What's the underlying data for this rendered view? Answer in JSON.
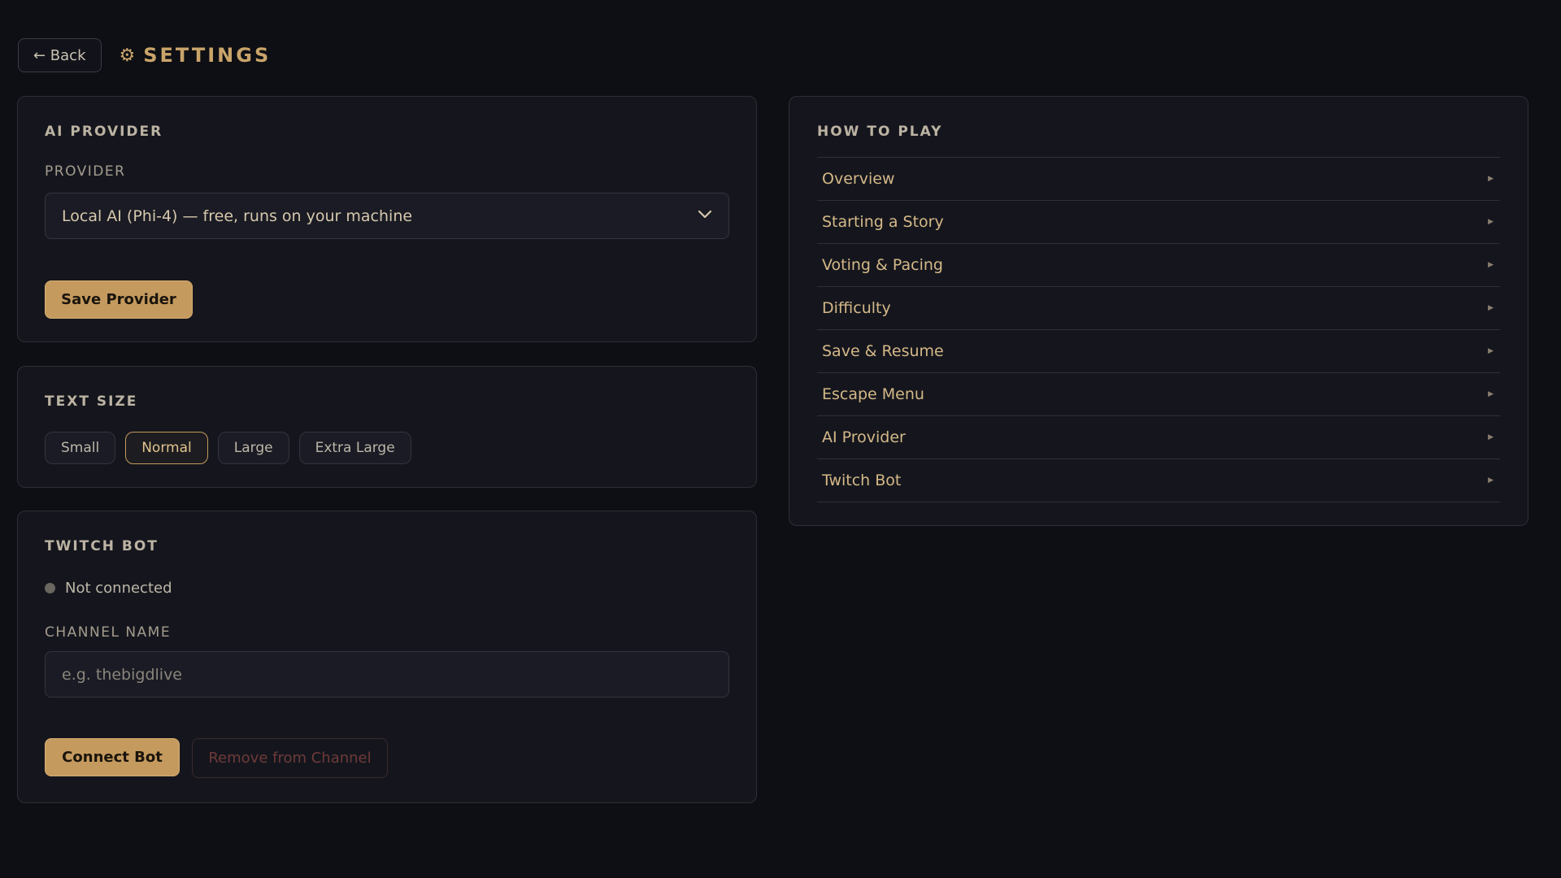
{
  "header": {
    "back_label": "← Back",
    "title_icon": "gear-icon",
    "title": "SETTINGS"
  },
  "ai_provider": {
    "heading": "AI PROVIDER",
    "provider_label": "PROVIDER",
    "selected_value": "Local AI (Phi-4) — free, runs on your machine",
    "save_label": "Save Provider"
  },
  "text_size": {
    "heading": "TEXT SIZE",
    "options": [
      "Small",
      "Normal",
      "Large",
      "Extra Large"
    ],
    "selected": "Normal"
  },
  "twitch_bot": {
    "heading": "TWITCH BOT",
    "status": "Not connected",
    "channel_label": "CHANNEL NAME",
    "channel_value": "",
    "channel_placeholder": "e.g. thebigdlive",
    "connect_label": "Connect Bot",
    "remove_label": "Remove from Channel"
  },
  "how_to_play": {
    "heading": "HOW TO PLAY",
    "items": [
      {
        "label": "Overview"
      },
      {
        "label": "Starting a Story"
      },
      {
        "label": "Voting & Pacing"
      },
      {
        "label": "Difficulty"
      },
      {
        "label": "Save & Resume"
      },
      {
        "label": "Escape Menu"
      },
      {
        "label": "AI Provider"
      },
      {
        "label": "Twitch Bot"
      }
    ],
    "item_icon": "triangle-right-icon"
  },
  "colors": {
    "background": "#0e0f14",
    "card": "#15161d",
    "accent_gold": "#c49a5e",
    "danger_text": "#6e3a3a",
    "status_dot": "#6a6660"
  }
}
